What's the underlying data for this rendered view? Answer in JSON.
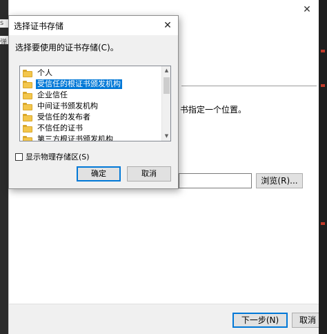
{
  "background": {
    "left_edge_fragments": [
      "s",
      "弹"
    ],
    "instruction_fragment": "书指定一个位置。",
    "browse_label": "浏览(R)...",
    "next_label": "下一步(N)",
    "cancel_label": "取消"
  },
  "dialog": {
    "title": "选择证书存储",
    "prompt": "选择要使用的证书存储(C)。",
    "stores": [
      {
        "label": "个人",
        "selected": false
      },
      {
        "label": "受信任的根证书颁发机构",
        "selected": true
      },
      {
        "label": "企业信任",
        "selected": false
      },
      {
        "label": "中间证书颁发机构",
        "selected": false
      },
      {
        "label": "受信任的发布者",
        "selected": false
      },
      {
        "label": "不信任的证书",
        "selected": false
      },
      {
        "label": "第三方根证书颁发机构",
        "selected": false
      }
    ],
    "show_physical_label": "显示物理存储区(S)",
    "show_physical_checked": false,
    "ok_label": "确定",
    "cancel_label": "取消"
  },
  "icons": {
    "folder": "folder-icon",
    "close": "close-icon",
    "scroll_up": "scroll-up-arrow-icon",
    "scroll_down": "scroll-down-arrow-icon"
  },
  "colors": {
    "selection": "#0078d7",
    "dialog_bg": "#f0f0f0",
    "folder": "#f3c64c"
  }
}
